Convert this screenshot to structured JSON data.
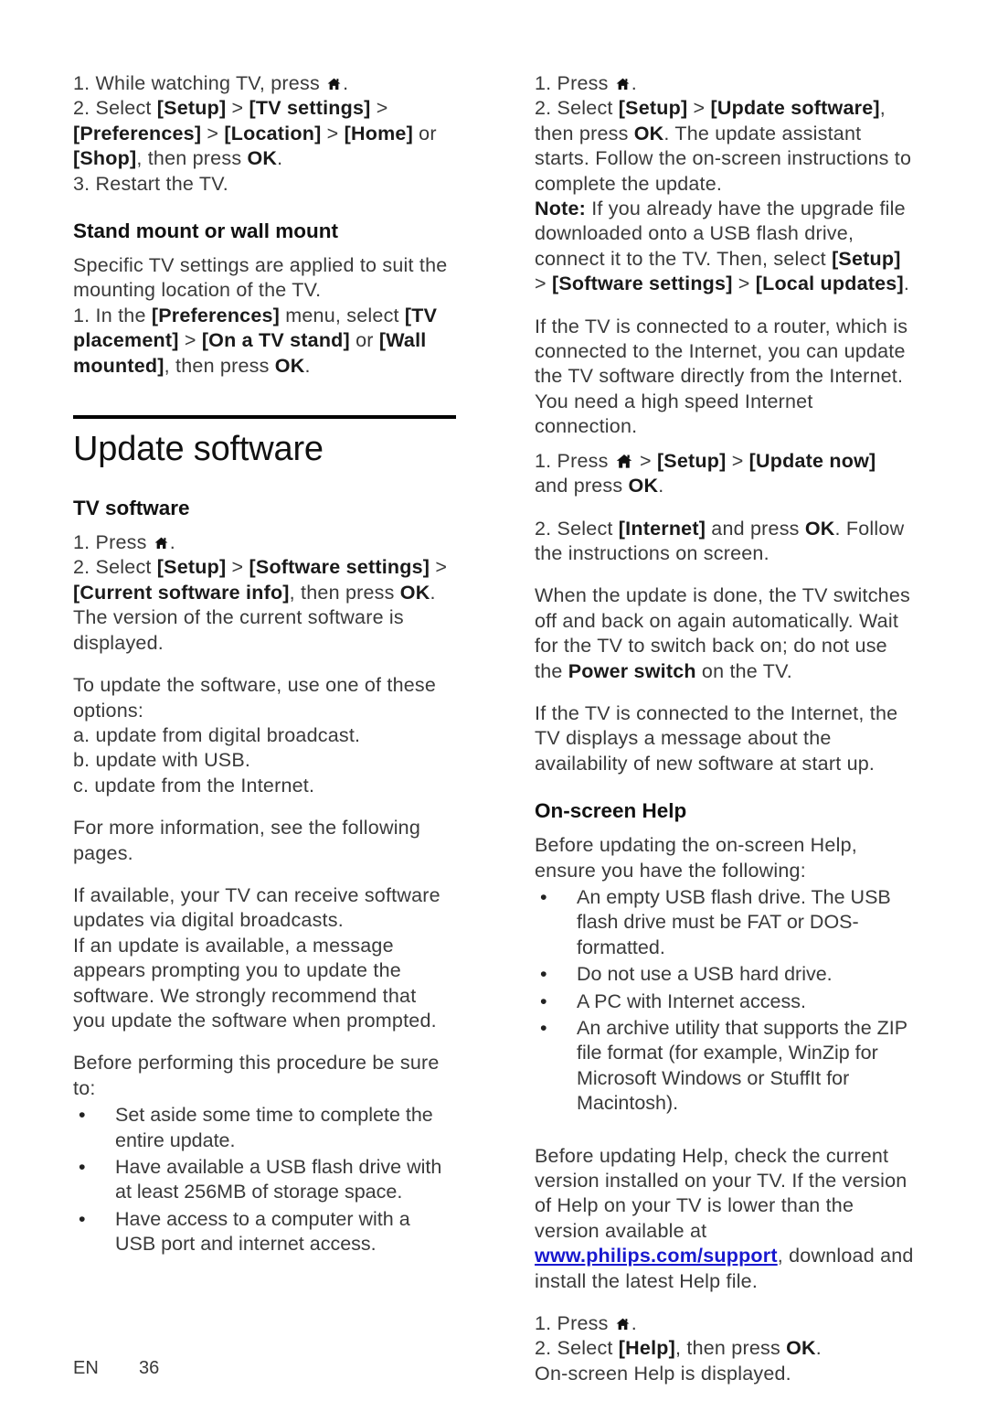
{
  "document": {
    "footer": {
      "language": "EN",
      "page_number": "36"
    }
  },
  "left_column": {
    "location_steps": {
      "line1_pre": "1. While watching TV, press ",
      "line1_post": ".",
      "line2_pre": "2. Select ",
      "line2_b1": "[Setup]",
      "line2_sep1": " > ",
      "line2_b2": "[TV settings]",
      "line2_sep2": " > ",
      "line2_b3": "[Preferences]",
      "line2_sep3": " > ",
      "line2_b4": "[Location]",
      "line2_sep4": " > ",
      "line2_b5": "[Home]",
      "line2_mid": " or ",
      "line2_b6": "[Shop]",
      "line2_tail": ", then press ",
      "line2_ok": "OK",
      "line2_end": ".",
      "line3": "3. Restart the TV."
    },
    "stand_mount_heading": "Stand mount or wall mount",
    "stand_mount_body": "Specific TV settings are applied to suit the mounting location of the TV.",
    "stand_mount_step": {
      "pre": "1. In the ",
      "b1": "[Preferences]",
      "mid1": " menu, select ",
      "b2": "[TV placement]",
      "sep": " > ",
      "b3": "[On a TV stand]",
      "mid2": " or ",
      "b4": "[Wall mounted]",
      "tail": ", then press ",
      "ok": "OK",
      "end": "."
    },
    "chapter_title": "Update software",
    "tv_software_heading": "TV software",
    "tv_software_steps": {
      "line1_pre": "1. Press ",
      "line1_post": ".",
      "line2_pre": "2. Select ",
      "b1": "[Setup]",
      "sep1": " > ",
      "b2": "[Software settings]",
      "sep2": " > ",
      "b3": "[Current software info]",
      "tail": ", then press ",
      "ok": "OK",
      "end": ". The version of the current software is displayed."
    },
    "options_intro": "To update the software, use one of these options:",
    "options": [
      "a. update from digital broadcast.",
      "b. update with USB.",
      "c. update from the Internet."
    ],
    "more_info": "For more information, see the following pages.",
    "digital_broadcast_para": "If available, your TV can receive software updates via digital broadcasts.",
    "prompt_para": "If an update is available, a message appears prompting you to update the software. We strongly recommend that you update the software when prompted.",
    "before_intro": "Before performing this procedure be sure to:",
    "before_bullets": [
      "Set aside some time to complete the entire update.",
      "Have available a USB flash drive with at least 256MB of storage space.",
      "Have access to a computer with a USB port and internet access."
    ]
  },
  "right_column": {
    "update_steps": {
      "line1_pre": "1. Press ",
      "line1_post": ".",
      "line2_pre": "2. Select ",
      "b1": "[Setup]",
      "sep1": " > ",
      "b2": "[Update software]",
      "mid1": ", then press ",
      "ok1": "OK",
      "mid2": ". The update assistant starts. Follow the on-screen instructions to complete the update.",
      "note_label": "Note:",
      "note_text": " If you already have the upgrade file downloaded onto a USB flash drive, connect it to the TV. Then, select ",
      "b3": "[Setup]",
      "sep2": " > ",
      "b4": "[Software settings]",
      "sep3": " > ",
      "b5": "[Local updates]",
      "note_end": "."
    },
    "router_para": "If the TV is connected to a router, which is connected to the Internet, you can update the TV software directly from the Internet. You need a high speed Internet connection.",
    "internet_steps": {
      "line1_pre": "1. Press ",
      "line1_sep1": " > ",
      "line1_b1": "[Setup]",
      "line1_sep2": " > ",
      "line1_b2": "[Update now]",
      "line1_mid": " and press ",
      "line1_ok": "OK",
      "line1_end": ".",
      "line2_pre": "2. Select ",
      "line2_b1": "[Internet]",
      "line2_mid": " and press ",
      "line2_ok": "OK",
      "line2_end": ". Follow the instructions on screen."
    },
    "update_done_para": {
      "pre": "When the update is done, the TV switches off and back on again automatically. Wait for the TV to switch back on; do not use the ",
      "bold": "Power switch",
      "post": " on the TV."
    },
    "availability_para": "If the TV is connected to the Internet, the TV displays a message about the availability of new software at start up.",
    "onscreen_help_heading": "On-screen Help",
    "help_intro": "Before updating the on-screen Help, ensure you have the following:",
    "help_bullets": [
      "An empty USB flash drive. The USB flash drive must be FAT or DOS-formatted.",
      "Do not use a USB hard drive.",
      "A PC with Internet access.",
      "An archive utility that supports the ZIP file format (for example, WinZip for Microsoft Windows or StuffIt for Macintosh)."
    ],
    "version_check_para": {
      "pre": "Before updating Help, check the current version installed on your TV. If the version of Help on your TV is lower than the version available at ",
      "link": "www.philips.com/support",
      "post": ", download and install the latest Help file."
    },
    "help_steps": {
      "line1_pre": "1. Press ",
      "line1_post": ".",
      "line2_pre": "2. Select ",
      "line2_b1": "[Help]",
      "line2_mid": ", then press ",
      "line2_ok": "OK",
      "line2_end": ".",
      "line3": "On-screen Help is displayed."
    }
  },
  "icons": {
    "home": "home-icon"
  }
}
